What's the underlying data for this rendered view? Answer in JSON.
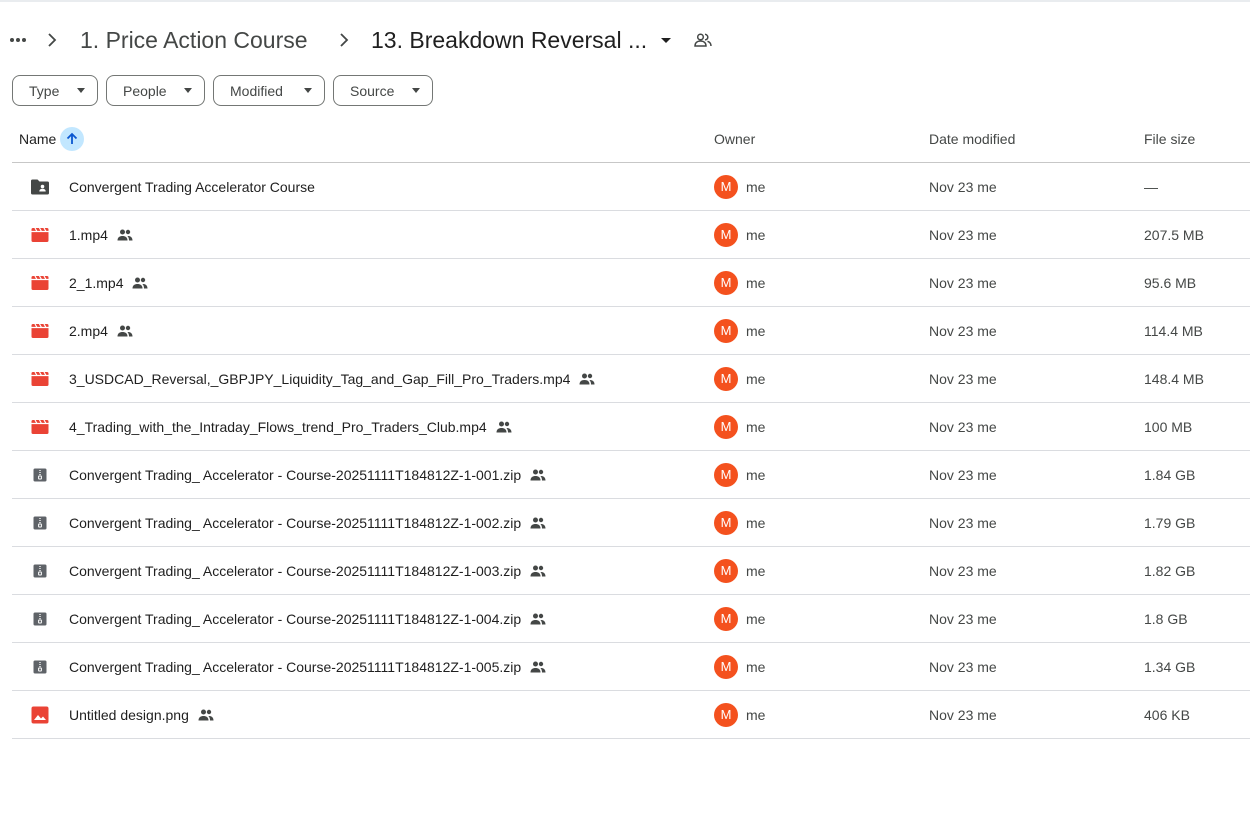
{
  "breadcrumb": {
    "parent": "1. Price Action Course",
    "current": "13. Breakdown Reversal ..."
  },
  "filters": [
    {
      "label": "Type"
    },
    {
      "label": "People"
    },
    {
      "label": "Modified"
    },
    {
      "label": "Source"
    }
  ],
  "columns": {
    "name": "Name",
    "owner": "Owner",
    "date": "Date modified",
    "size": "File size"
  },
  "rows": [
    {
      "icon": "shared-folder-icon",
      "name": "Convergent Trading Accelerator Course",
      "shared": false,
      "avatar": "M",
      "owner": "me",
      "date": "Nov 23 me",
      "size": "—"
    },
    {
      "icon": "video-icon",
      "name": "1.mp4",
      "shared": true,
      "avatar": "M",
      "owner": "me",
      "date": "Nov 23 me",
      "size": "207.5 MB"
    },
    {
      "icon": "video-icon",
      "name": "2_1.mp4",
      "shared": true,
      "avatar": "M",
      "owner": "me",
      "date": "Nov 23 me",
      "size": "95.6 MB"
    },
    {
      "icon": "video-icon",
      "name": "2.mp4",
      "shared": true,
      "avatar": "M",
      "owner": "me",
      "date": "Nov 23 me",
      "size": "114.4 MB"
    },
    {
      "icon": "video-icon",
      "name": "3_USDCAD_Reversal,_GBPJPY_Liquidity_Tag_and_Gap_Fill_Pro_Traders.mp4",
      "shared": true,
      "avatar": "M",
      "owner": "me",
      "date": "Nov 23 me",
      "size": "148.4 MB"
    },
    {
      "icon": "video-icon",
      "name": "4_Trading_with_the_Intraday_Flows_trend_Pro_Traders_Club.mp4",
      "shared": true,
      "avatar": "M",
      "owner": "me",
      "date": "Nov 23 me",
      "size": "100 MB"
    },
    {
      "icon": "zip-icon",
      "name": "Convergent Trading_ Accelerator - Course-20251111T184812Z-1-001.zip",
      "shared": true,
      "avatar": "M",
      "owner": "me",
      "date": "Nov 23 me",
      "size": "1.84 GB"
    },
    {
      "icon": "zip-icon",
      "name": "Convergent Trading_ Accelerator - Course-20251111T184812Z-1-002.zip",
      "shared": true,
      "avatar": "M",
      "owner": "me",
      "date": "Nov 23 me",
      "size": "1.79 GB"
    },
    {
      "icon": "zip-icon",
      "name": "Convergent Trading_ Accelerator - Course-20251111T184812Z-1-003.zip",
      "shared": true,
      "avatar": "M",
      "owner": "me",
      "date": "Nov 23 me",
      "size": "1.82 GB"
    },
    {
      "icon": "zip-icon",
      "name": "Convergent Trading_ Accelerator - Course-20251111T184812Z-1-004.zip",
      "shared": true,
      "avatar": "M",
      "owner": "me",
      "date": "Nov 23 me",
      "size": "1.8 GB"
    },
    {
      "icon": "zip-icon",
      "name": "Convergent Trading_ Accelerator - Course-20251111T184812Z-1-005.zip",
      "shared": true,
      "avatar": "M",
      "owner": "me",
      "date": "Nov 23 me",
      "size": "1.34 GB"
    },
    {
      "icon": "image-icon",
      "name": "Untitled design.png",
      "shared": true,
      "avatar": "M",
      "owner": "me",
      "date": "Nov 23 me",
      "size": "406 KB"
    }
  ],
  "colors": {
    "avatar": "#f4511e",
    "video": "#ea4335",
    "image": "#ea4335",
    "zip": "#5f6368",
    "folder": "#444746",
    "sort_highlight": "#c2e7ff"
  }
}
